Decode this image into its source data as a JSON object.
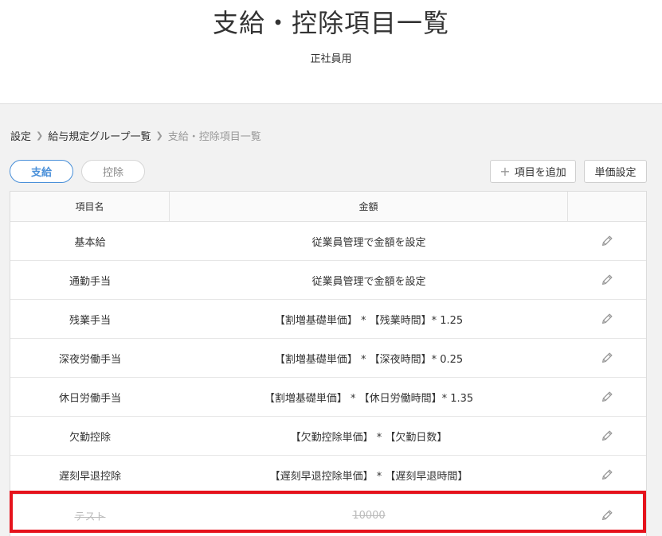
{
  "header": {
    "title": "支給・控除項目一覧",
    "subtitle": "正社員用"
  },
  "breadcrumb": [
    {
      "label": "設定"
    },
    {
      "label": "給与規定グループ一覧"
    },
    {
      "label": "支給・控除項目一覧"
    }
  ],
  "tabs": [
    {
      "label": "支給",
      "active": true
    },
    {
      "label": "控除",
      "active": false
    }
  ],
  "toolbar": {
    "add_label": "項目を追加",
    "unit_label": "単価設定"
  },
  "table": {
    "columns": [
      "項目名",
      "金額",
      ""
    ],
    "rows": [
      {
        "name": "基本給",
        "amount": "従業員管理で金額を設定"
      },
      {
        "name": "通勤手当",
        "amount": "従業員管理で金額を設定"
      },
      {
        "name": "残業手当",
        "amount": "【割増基礎単価】 * 【残業時間】* 1.25"
      },
      {
        "name": "深夜労働手当",
        "amount": "【割増基礎単価】 * 【深夜時間】* 0.25"
      },
      {
        "name": "休日労働手当",
        "amount": "【割増基礎単価】 * 【休日労働時間】* 1.35"
      },
      {
        "name": "欠勤控除",
        "amount": "【欠勤控除単価】 * 【欠勤日数】"
      },
      {
        "name": "遅刻早退控除",
        "amount": "【遅刻早退控除単価】 * 【遅刻早退時間】"
      },
      {
        "name": "テスト",
        "amount": "10000",
        "disabled": true
      }
    ]
  },
  "colors": {
    "accent": "#4a90d9",
    "highlight": "#e5131c"
  },
  "icons": {
    "edit": "pencil-icon",
    "add": "plus-icon",
    "breadcrumb_separator": "chevron-right-icon"
  }
}
